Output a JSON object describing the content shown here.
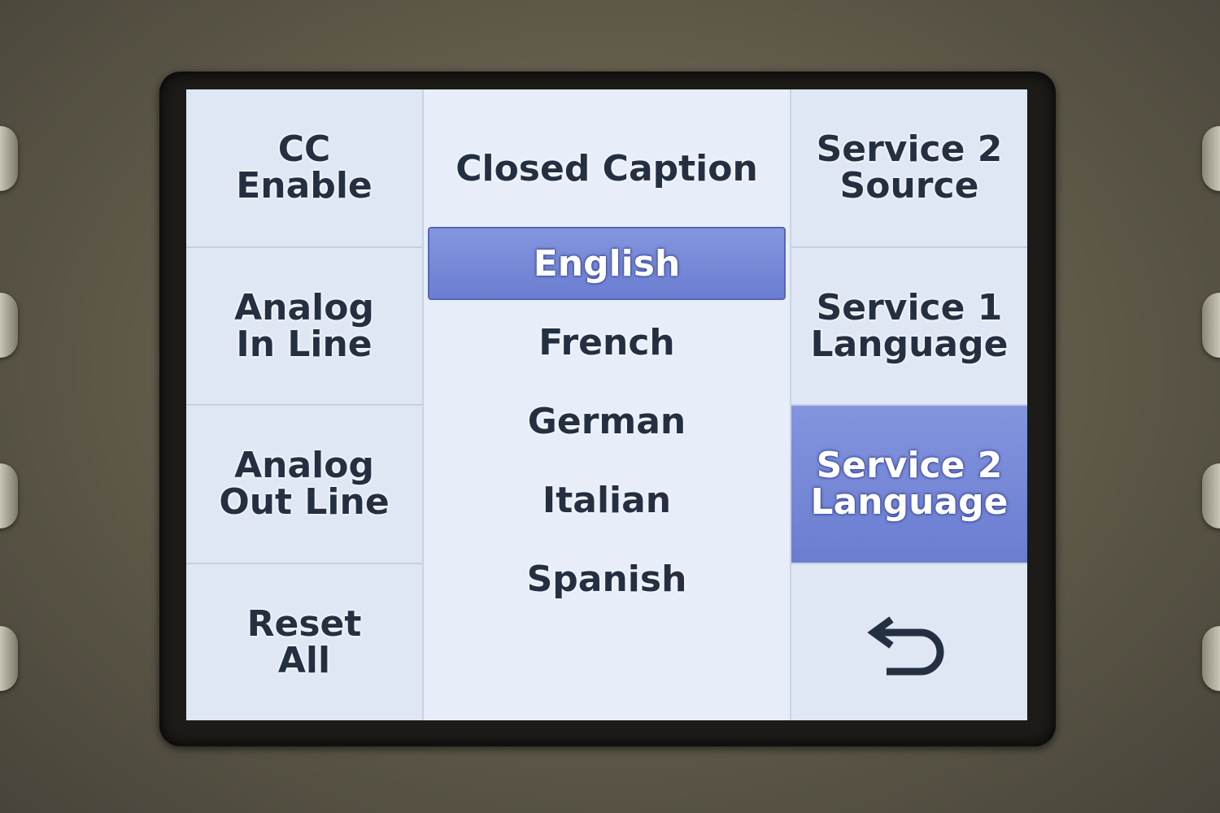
{
  "left_softkeys": [
    {
      "label": "CC\nEnable"
    },
    {
      "label": "Analog\nIn Line"
    },
    {
      "label": "Analog\nOut Line"
    },
    {
      "label": "Reset\nAll"
    }
  ],
  "center": {
    "title": "Closed Caption",
    "options": [
      "English",
      "French",
      "German",
      "Italian",
      "Spanish"
    ],
    "selected_option": "English"
  },
  "right_softkeys": [
    {
      "label": "Service 2\nSource"
    },
    {
      "label": "Service 1\nLanguage"
    },
    {
      "label": "Service 2\nLanguage",
      "selected": true
    },
    {
      "icon": "back-arrow-icon"
    }
  ],
  "colors": {
    "selection": "#7486d6",
    "panel": "#dfe7f4",
    "text": "#243042"
  }
}
